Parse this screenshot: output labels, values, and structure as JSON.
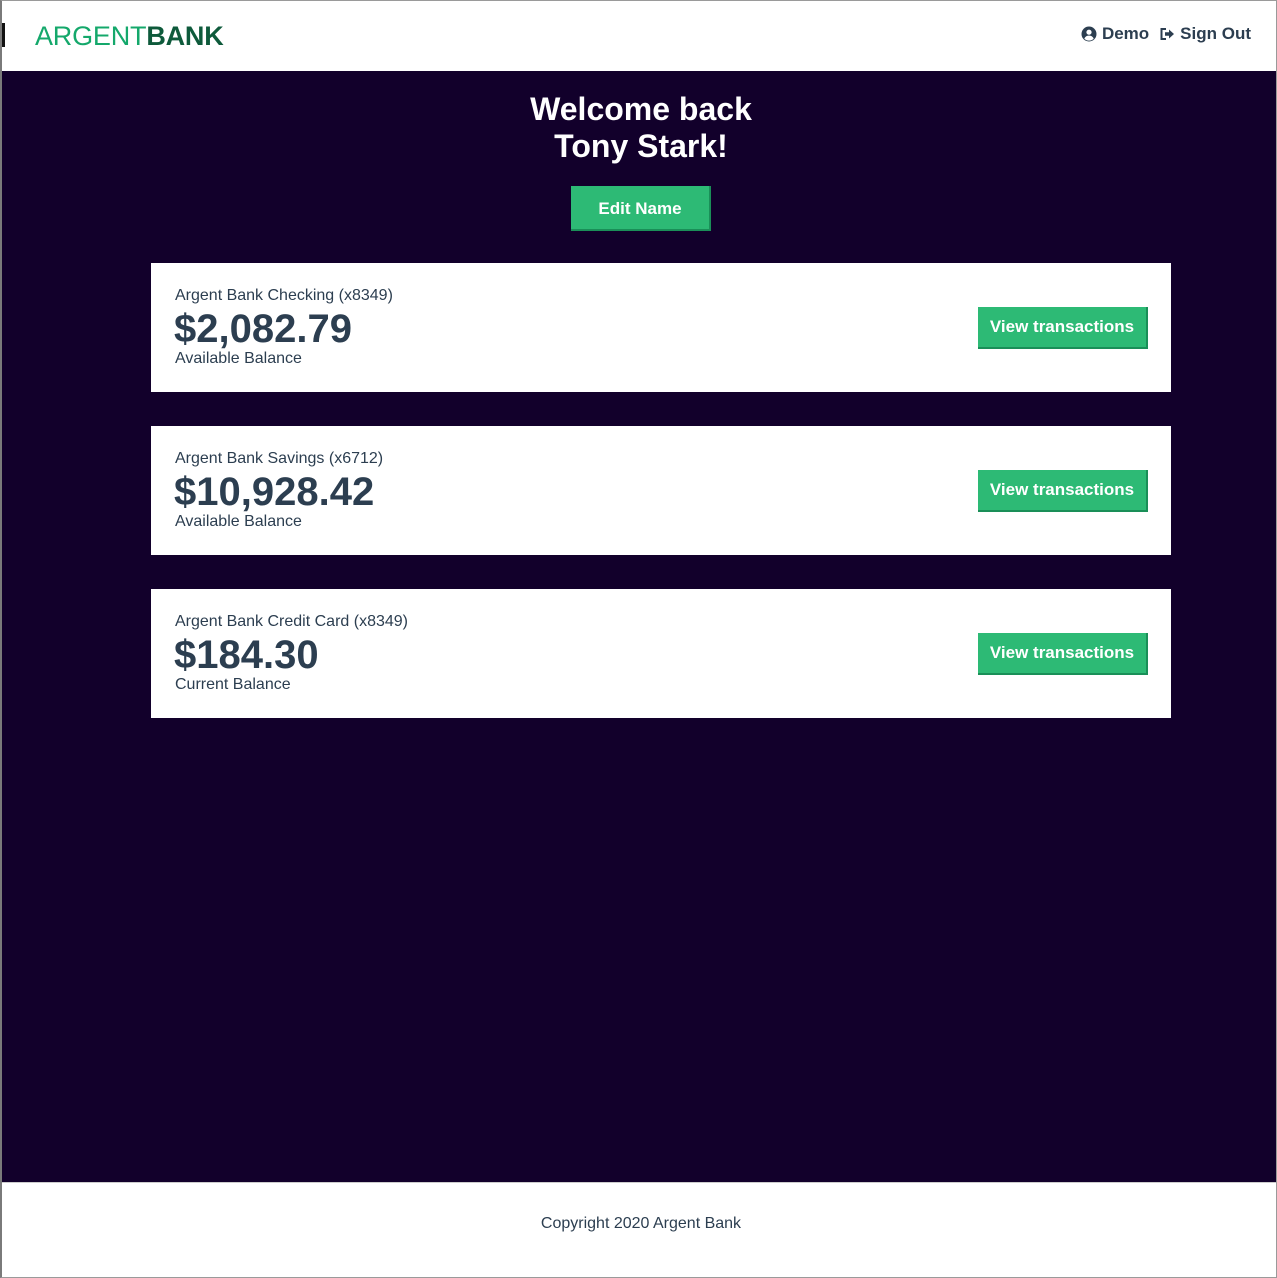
{
  "header": {
    "logo_part1": "ARGENT",
    "logo_part2": "BANK",
    "user_label": "Demo",
    "signout_label": "Sign Out",
    "user_icon": "user-circle-icon",
    "signout_icon": "sign-out-icon"
  },
  "main": {
    "welcome_line1": "Welcome back",
    "welcome_line2": "Tony Stark!",
    "edit_name_label": "Edit Name"
  },
  "accounts": [
    {
      "title": "Argent Bank Checking (x8349)",
      "amount": "$2,082.79",
      "description": "Available Balance",
      "button_label": "View transactions"
    },
    {
      "title": "Argent Bank Savings (x6712)",
      "amount": "$10,928.42",
      "description": "Available Balance",
      "button_label": "View transactions"
    },
    {
      "title": "Argent Bank Credit Card (x8349)",
      "amount": "$184.30",
      "description": "Current Balance",
      "button_label": "View transactions"
    }
  ],
  "footer": {
    "copyright": "Copyright 2020 Argent Bank"
  },
  "colors": {
    "brand_green": "#2dba75",
    "logo_light": "#14a86b",
    "logo_dark": "#0e5a3b",
    "main_bg": "#12002b",
    "text_dark": "#2c3e50"
  }
}
